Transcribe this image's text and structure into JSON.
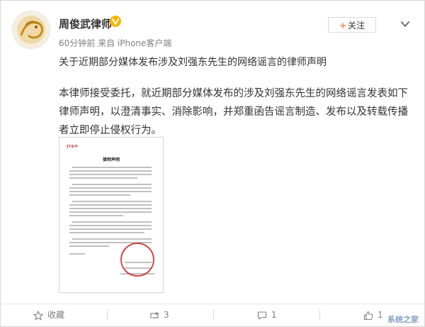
{
  "post": {
    "author": "周俊武律师",
    "meta": "60分钟前 来自 iPhone客户端",
    "follow_label": "关注",
    "headline": "关于近期部分媒体发布涉及刘强东先生的网络谣言的律师声明",
    "body": "本律师接受委托，就近期部分媒体发布的涉及刘强东先生的网络谣言发表如下律师声明，以澄清事实、消除影响，并郑重函告谣言制造、发布以及转载传播者立即停止侵权行为。",
    "attachment": {
      "logo": "ĮT&N",
      "title": "律师声明"
    }
  },
  "actions": {
    "favorite_label": "收藏",
    "repost_count": "3",
    "comment_count": "1",
    "like_count": "1"
  },
  "watermark": "系统之家",
  "colors": {
    "accent": "#ff8140",
    "text": "#333333",
    "muted": "#808080",
    "verified": "#f6b600"
  }
}
